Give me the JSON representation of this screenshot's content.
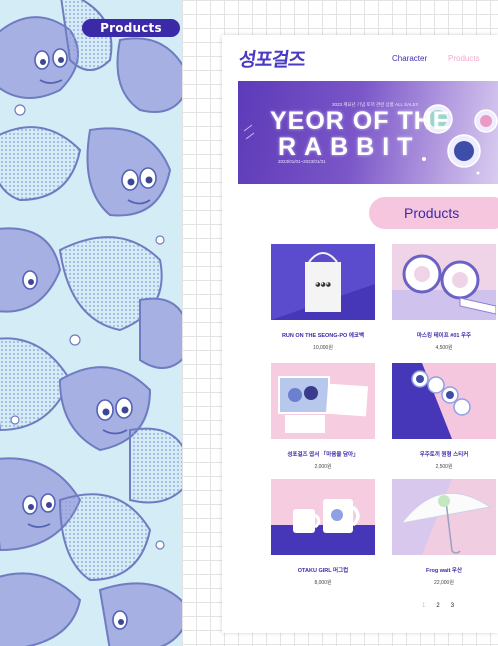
{
  "side_badge": "Products",
  "site": {
    "logo": "성포걸즈",
    "nav": [
      {
        "label": "Character",
        "active": false
      },
      {
        "label": "Products",
        "active": true
      }
    ]
  },
  "banner": {
    "subtitle": "2023 계묘년 기념 토끼 관련 상품 ALL SALE!!",
    "title_line1": "YEOR OF THE",
    "title_line2": "RABBIT",
    "dates": "2023/01/01~2023/01/31"
  },
  "section_title": "Products",
  "products": [
    {
      "name": "RUN ON THE SEONG-PO 에코백",
      "price": "10,000원",
      "icon": "tote-bag-icon"
    },
    {
      "name": "마스킹 테이프 #01 우주",
      "price": "4,500원",
      "icon": "masking-tape-icon"
    },
    {
      "name": "성포걸즈 엽서 「마음을 담아」",
      "price": "2,000원",
      "icon": "postcard-icon"
    },
    {
      "name": "우주토끼 원형 스티커",
      "price": "2,500원",
      "icon": "sticker-icon"
    },
    {
      "name": "OTAKU GIRL 머그컵",
      "price": "8,000원",
      "icon": "mug-icon"
    },
    {
      "name": "Frog wait 우산",
      "price": "22,000원",
      "icon": "umbrella-icon"
    }
  ],
  "pagination": [
    {
      "label": "1",
      "current": true
    },
    {
      "label": "2",
      "current": false
    },
    {
      "label": "3",
      "current": false
    }
  ],
  "colors": {
    "accent": "#3a2aa8",
    "pink": "#f6c6df",
    "illustration_bg": "#d4ecf6",
    "illustration_ink": "#9aa6dc"
  }
}
